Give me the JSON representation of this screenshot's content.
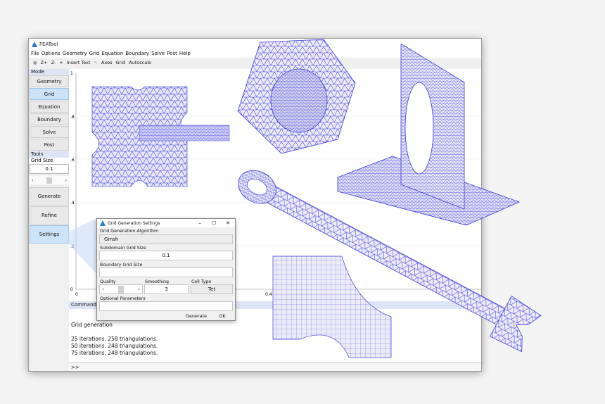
{
  "window": {
    "title": "FEATool"
  },
  "menu": [
    "File",
    "Options",
    "Geometry",
    "Grid",
    "Equation",
    "Boundary",
    "Solve",
    "Post",
    "Help"
  ],
  "toolbar": [
    "Z+",
    "Z-",
    "+",
    "Insert Text",
    "Axes",
    "Grid",
    "Autoscale"
  ],
  "mode": {
    "header": "Mode",
    "buttons": [
      "Geometry",
      "Grid",
      "Equation",
      "Boundary",
      "Solve",
      "Post"
    ],
    "active": "Grid"
  },
  "tools": {
    "header": "Tools",
    "grid_size_label": "Grid Size",
    "grid_size_value": "0.1",
    "generate": "Generate",
    "refine": "Refine",
    "settings": "Settings"
  },
  "axes": {
    "y_ticks": [
      "1",
      ".8",
      ".6",
      ".4",
      ".2",
      "0"
    ],
    "x_ticks": [
      "0",
      "0.4"
    ]
  },
  "command": {
    "header": "Command",
    "lines": [
      "Grid generation",
      "",
      "25 iterations, 258 triangulations.",
      "50 iterations, 248 triangulations.",
      "75 iterations, 248 triangulations."
    ],
    "prompt": ">>"
  },
  "dialog": {
    "title": "Grid Generation Settings",
    "algorithm_label": "Grid Generation Algorithm",
    "algorithm_value": "Gmsh",
    "subdomain_label": "Subdomain Grid Size",
    "subdomain_value": "0.1",
    "boundary_label": "Boundary Grid Size",
    "quality_label": "Quality",
    "smoothing_label": "Smoothing",
    "smoothing_value": "3",
    "celltype_label": "Cell Type",
    "celltype_value": "Tet",
    "optional_label": "Optional Parameters",
    "generate": "Generate",
    "ok": "OK"
  },
  "colors": {
    "mesh": "#3a3ae0",
    "accent": "#cde3f8"
  }
}
